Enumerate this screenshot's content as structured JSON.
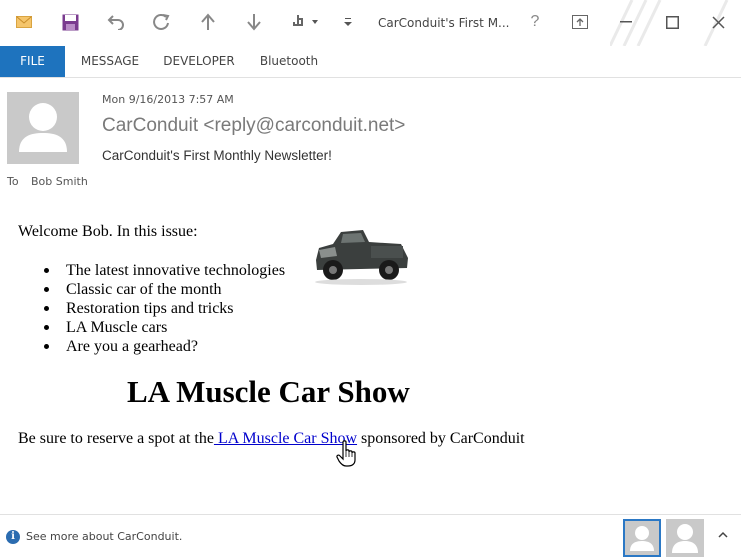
{
  "window": {
    "title": "CarConduit's First M..."
  },
  "ribbon": {
    "tabs": [
      "FILE",
      "MESSAGE",
      "DEVELOPER",
      "Bluetooth"
    ]
  },
  "header": {
    "date": "Mon 9/16/2013 7:57 AM",
    "sender": "CarConduit <reply@carconduit.net>",
    "subject": "CarConduit's First Monthly Newsletter!",
    "to_label": "To",
    "to_name": "Bob Smith"
  },
  "body": {
    "welcome": "Welcome Bob. In this issue:",
    "issue_items": [
      "The latest innovative technologies",
      "Classic car of the month",
      "Restoration tips and tricks",
      "LA Muscle cars",
      "Are you a gearhead?"
    ],
    "headline": "LA Muscle Car Show",
    "reserve_prefix": "Be sure to reserve a spot at the",
    "link_text": " LA Muscle Car Show",
    "reserve_suffix": " sponsored by CarConduit"
  },
  "footer": {
    "people_pane_text": "See more about CarConduit."
  },
  "colors": {
    "accent": "#1e73be",
    "link": "#0000cc"
  }
}
